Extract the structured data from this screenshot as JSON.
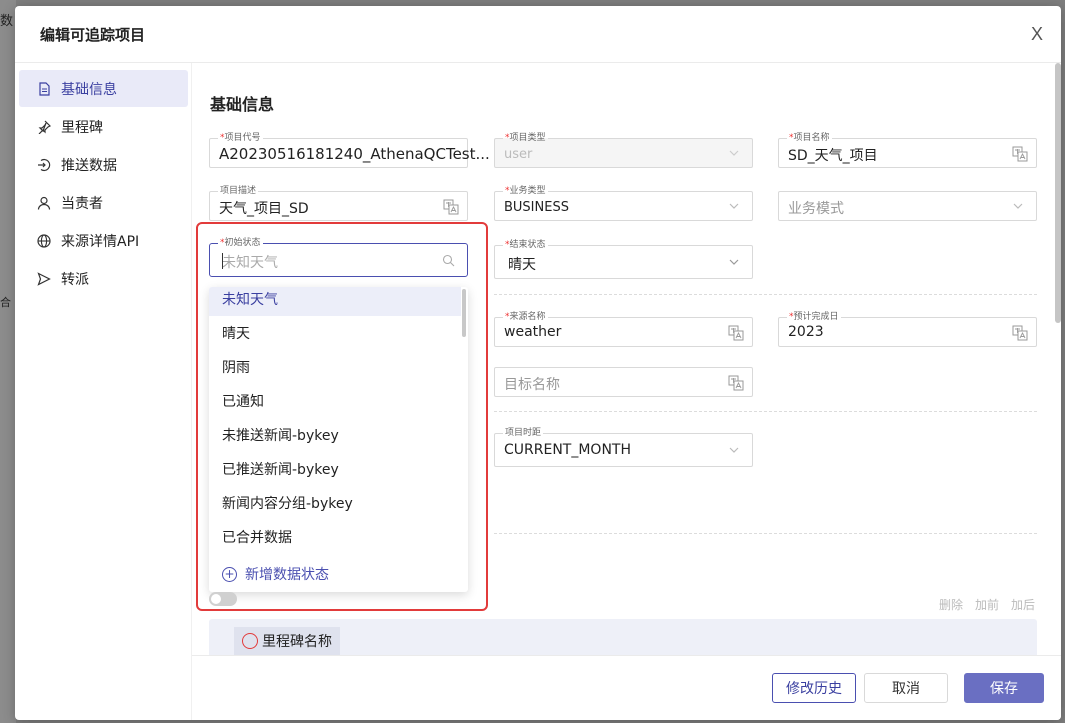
{
  "background": {
    "text_top": "数",
    "text_mid": "合"
  },
  "modal": {
    "title": "编辑可追踪项目",
    "close_label": "X"
  },
  "sidenav": {
    "items": [
      {
        "label": "基础信息",
        "icon": "document-icon",
        "active": true
      },
      {
        "label": "里程碑",
        "icon": "pin-icon",
        "active": false
      },
      {
        "label": "推送数据",
        "icon": "push-icon",
        "active": false
      },
      {
        "label": "当责者",
        "icon": "user-icon",
        "active": false
      },
      {
        "label": "来源详情API",
        "icon": "globe-icon",
        "active": false
      },
      {
        "label": "转派",
        "icon": "send-icon",
        "active": false
      }
    ]
  },
  "section": {
    "title": "基础信息"
  },
  "fields": {
    "project_code": {
      "label": "项目代号",
      "value": "A20230516181240_AthenaQCTest..."
    },
    "project_type": {
      "label": "项目类型",
      "value": "user"
    },
    "project_name": {
      "label": "项目名称",
      "value": "SD_天气_项目"
    },
    "project_desc": {
      "label": "项目描述",
      "value": "天气_项目_SD"
    },
    "business_type": {
      "label": "业务类型",
      "value": "BUSINESS"
    },
    "business_mode": {
      "placeholder": "业务模式"
    },
    "initial_state": {
      "label": "初始状态",
      "placeholder": "未知天气"
    },
    "end_state": {
      "label": "结束状态",
      "value": "晴天"
    },
    "source_name": {
      "label": "来源名称",
      "value": "weather"
    },
    "planned_date": {
      "label": "预计完成日",
      "value": "2023"
    },
    "target_name": {
      "placeholder": "目标名称"
    },
    "project_period": {
      "label": "项目时距",
      "value": "CURRENT_MONTH"
    }
  },
  "dropdown": {
    "options": [
      "未知天气",
      "晴天",
      "阴雨",
      "已通知",
      "未推送新闻-bykey",
      "已推送新闻-bykey",
      "新闻内容分组-bykey",
      "已合并数据"
    ],
    "selected_index": 0,
    "add_label": "新增数据状态"
  },
  "row_actions": {
    "delete": "删除",
    "add_before": "加前",
    "add_after": "加后"
  },
  "milestone": {
    "chip_label": "里程碑名称"
  },
  "footer": {
    "history": "修改历史",
    "cancel": "取消",
    "save": "保存"
  },
  "colors": {
    "accent": "#4a4fb0",
    "highlight_box": "#e23b3b",
    "required": "#e33333"
  }
}
